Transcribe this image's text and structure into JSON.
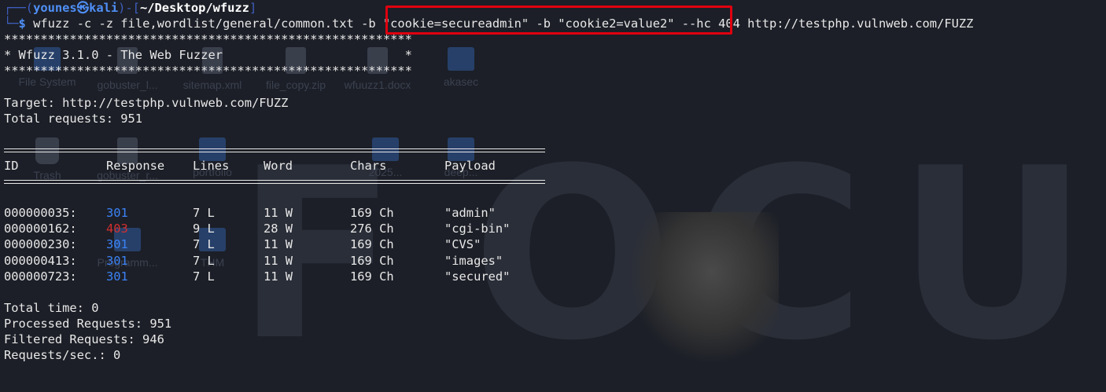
{
  "prompt": {
    "frame_open": "┌──(",
    "user": "younes㉿kali",
    "frame_mid": ")-[",
    "path": "~/Desktop/wfuzz",
    "frame_close": "]",
    "frame_bottom": "└─",
    "dollar": "$",
    "command_prefix": " wfuzz -c -z file,wordlist/general/common.txt ",
    "command_cookies": "-b \"cookie=secureadmin\" -b \"cookie2=value2\"",
    "command_suffix": " --hc 404 http://testphp.vulnweb.com/FUZZ"
  },
  "banner": {
    "stars": "********************************************************",
    "title": "* Wfuzz 3.1.0 - The Web Fuzzer                         *"
  },
  "target_line": "Target: http://testphp.vulnweb.com/FUZZ",
  "total_requests_line": "Total requests: 951",
  "table": {
    "headers": [
      "ID",
      "Response",
      "Lines",
      "Word",
      "Chars",
      "Payload"
    ],
    "rows": [
      {
        "id": "000000035:",
        "response": "301",
        "lines": "7 L",
        "word": "11 W",
        "chars": "169 Ch",
        "payload": "\"admin\""
      },
      {
        "id": "000000162:",
        "response": "403",
        "lines": "9 L",
        "word": "28 W",
        "chars": "276 Ch",
        "payload": "\"cgi-bin\""
      },
      {
        "id": "000000230:",
        "response": "301",
        "lines": "7 L",
        "word": "11 W",
        "chars": "169 Ch",
        "payload": "\"CVS\""
      },
      {
        "id": "000000413:",
        "response": "301",
        "lines": "7 L",
        "word": "11 W",
        "chars": "169 Ch",
        "payload": "\"images\""
      },
      {
        "id": "000000723:",
        "response": "301",
        "lines": "7 L",
        "word": "11 W",
        "chars": "169 Ch",
        "payload": "\"secured\""
      }
    ]
  },
  "summary": {
    "total_time": "Total time: 0",
    "processed": "Processed Requests: 951",
    "filtered": "Filtered Requests: 946",
    "rate": "Requests/sec.: 0"
  },
  "desktop_icons": [
    "File System",
    "gobuster_l...",
    "sitemap.xml",
    "file_copy.zip",
    "wfuuzz1.docx",
    "akasec",
    "Trash",
    "gobuster_r...",
    "portfolio",
    "2025...",
    "deep...",
    "Programm...",
    "THM"
  ],
  "wallpaper_text": [
    "F",
    "O",
    "C",
    "U"
  ],
  "colors": {
    "status_301": "#3b82f6",
    "status_403": "#d32f2f",
    "highlight_box": "#e0000f",
    "prompt_user": "#4f8ff7"
  }
}
